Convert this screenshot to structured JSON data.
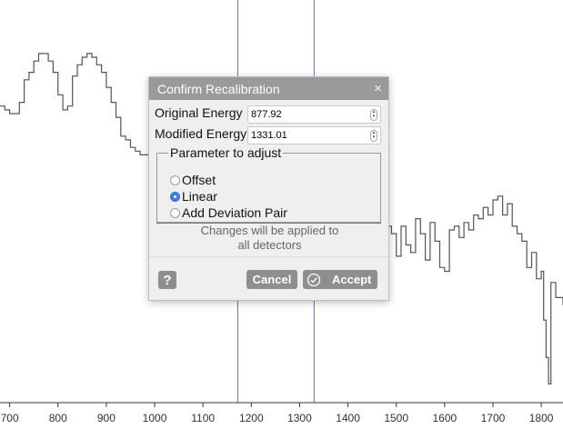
{
  "chart_data": {
    "type": "line",
    "x_tick_labels": [
      "700",
      "800",
      "900",
      "1000",
      "1100",
      "1200",
      "1300",
      "1400",
      "1500",
      "1600",
      "1700",
      "1800"
    ],
    "xlim": [
      680,
      1845
    ],
    "ylim": [
      0,
      1
    ],
    "grid": false,
    "markers": [
      {
        "name": "original-energy-marker",
        "x": 1172,
        "color": "#5b6ee1"
      },
      {
        "name": "modified-energy-marker",
        "x": 1330,
        "color": "#5b6ee1"
      }
    ],
    "series": [
      {
        "color": "#555555",
        "x": [
          680,
          690,
          700,
          710,
          720,
          730,
          740,
          750,
          760,
          770,
          780,
          790,
          800,
          810,
          820,
          830,
          840,
          850,
          860,
          870,
          880,
          890,
          900,
          910,
          920,
          930,
          940,
          950,
          960,
          970,
          980,
          990,
          1000,
          1010,
          1020,
          1030,
          1040,
          1050,
          1060,
          1070,
          1080,
          1090,
          1100,
          1110,
          1120,
          1130,
          1140,
          1150,
          1160,
          1170,
          1180,
          1190,
          1200,
          1210,
          1220,
          1230,
          1240,
          1250,
          1260,
          1270,
          1280,
          1290,
          1300,
          1310,
          1320,
          1330,
          1340,
          1350,
          1360,
          1370,
          1380,
          1390,
          1400,
          1410,
          1420,
          1430,
          1440,
          1450,
          1460,
          1470,
          1480,
          1490,
          1500,
          1510,
          1520,
          1530,
          1540,
          1550,
          1560,
          1570,
          1580,
          1590,
          1600,
          1610,
          1620,
          1630,
          1640,
          1650,
          1660,
          1670,
          1680,
          1690,
          1700,
          1710,
          1720,
          1730,
          1740,
          1750,
          1760,
          1770,
          1780,
          1790,
          1800,
          1805,
          1810,
          1815,
          1820,
          1830,
          1845
        ],
        "y": [
          0.79,
          0.78,
          0.77,
          0.77,
          0.8,
          0.86,
          0.88,
          0.91,
          0.93,
          0.93,
          0.91,
          0.88,
          0.82,
          0.78,
          0.79,
          0.87,
          0.9,
          0.92,
          0.93,
          0.92,
          0.9,
          0.88,
          0.84,
          0.8,
          0.76,
          0.71,
          0.7,
          0.68,
          0.67,
          0.66,
          0.66,
          0.66,
          0.65,
          0.64,
          0.63,
          0.62,
          0.61,
          0.6,
          0.59,
          0.58,
          0.58,
          0.57,
          0.56,
          0.55,
          0.55,
          0.54,
          0.54,
          0.53,
          0.52,
          0.52,
          0.51,
          0.51,
          0.5,
          0.5,
          0.5,
          0.49,
          0.49,
          0.48,
          0.48,
          0.48,
          0.47,
          0.47,
          0.47,
          0.46,
          0.46,
          0.46,
          0.46,
          0.46,
          0.46,
          0.46,
          0.45,
          0.45,
          0.48,
          0.47,
          0.44,
          0.49,
          0.45,
          0.43,
          0.5,
          0.42,
          0.47,
          0.45,
          0.39,
          0.47,
          0.42,
          0.4,
          0.49,
          0.45,
          0.38,
          0.48,
          0.43,
          0.36,
          0.35,
          0.46,
          0.47,
          0.44,
          0.48,
          0.46,
          0.5,
          0.49,
          0.52,
          0.5,
          0.54,
          0.55,
          0.5,
          0.53,
          0.47,
          0.45,
          0.43,
          0.36,
          0.4,
          0.33,
          0.35,
          0.22,
          0.12,
          0.05,
          0.32,
          0.28,
          0.26
        ]
      }
    ]
  },
  "dialog": {
    "title": "Confirm Recalibration",
    "close_glyph": "×",
    "original_energy_label": "Original Energy",
    "original_energy_value": "877.92",
    "modified_energy_label": "Modified Energy",
    "modified_energy_value": "1331.01",
    "fieldset_legend": "Parameter to adjust",
    "options": [
      {
        "label": "Offset",
        "checked": false
      },
      {
        "label": "Linear",
        "checked": true
      },
      {
        "label": "Add Deviation Pair",
        "checked": false
      }
    ],
    "note_line1": "Changes will be applied to",
    "note_line2": "all detectors",
    "help_glyph": "?",
    "cancel_label": "Cancel",
    "accept_label": "Accept"
  },
  "icons": {
    "close": "close-icon",
    "help": "help-icon",
    "accept": "check-circle-icon",
    "spin": "spinner-arrows-icon"
  },
  "colors": {
    "title_bar": "#9a9a9a",
    "button": "#8e8e8e",
    "radio_checked": "#3b82f6",
    "marker_line": "#5b6ee1",
    "spectrum": "#555555"
  }
}
